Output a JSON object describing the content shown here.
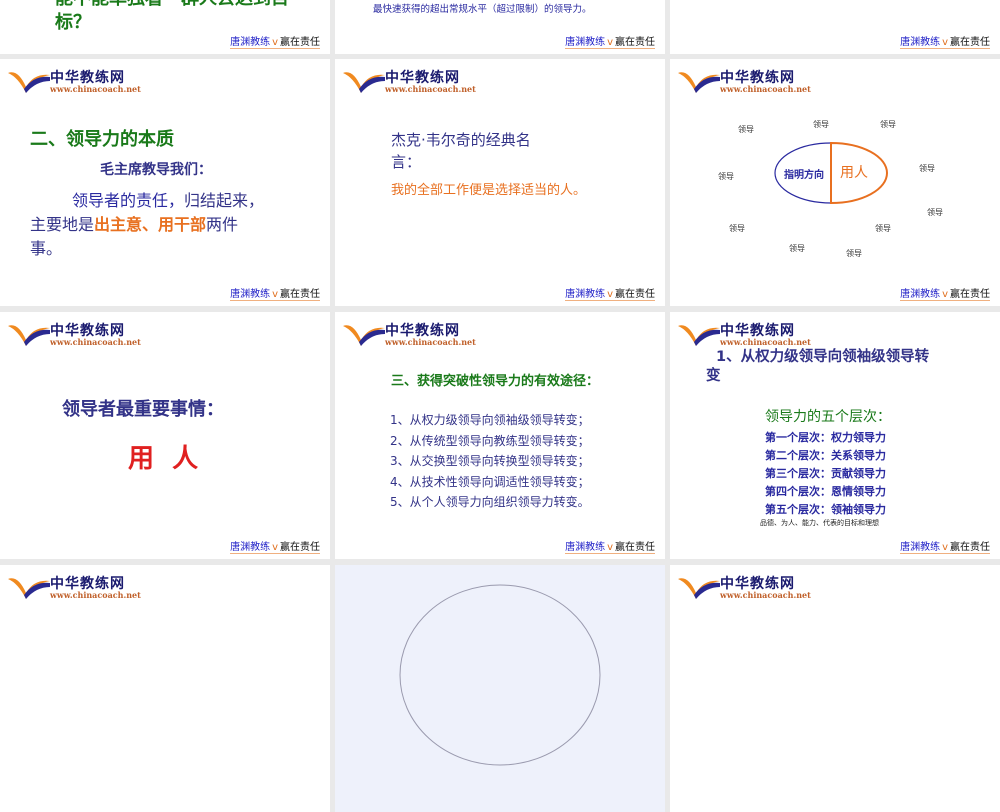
{
  "logo": {
    "brand": "中华教练网",
    "url": "www.chinacoach.net"
  },
  "footer": {
    "name": "唐渊教练",
    "v": "v",
    "slogan": "赢在责任"
  },
  "slides": [
    {
      "line1": "能不能单独看一群人去达到目",
      "line2": "标？"
    },
    {
      "text": "最快速获得的超出常规水平（超过限制）的领导力。"
    },
    {},
    {
      "title": "二、领导力的本质",
      "subtitle": "毛主席教导我们：",
      "p1": "领导者的责任，",
      "p1b": "归结起来，",
      "p2a": "主要地是",
      "p2b": "出主意、用干部",
      "p2c": "两件",
      "p3": "事。"
    },
    {
      "title_line1": "杰克·韦尔奇的经典名",
      "title_line2": "言：",
      "quote": "我的全部工作便是选择适当的人。"
    },
    {
      "left": "指明方向",
      "right": "用人",
      "satellite": "领导"
    },
    {
      "heading": "领导者最重要事情：",
      "big": "用  人"
    },
    {
      "title": "三、获得突破性领导力的有效途径：",
      "items": [
        "1、从权力级领导向领袖级领导转变；",
        "2、从传统型领导向教练型领导转变；",
        "3、从交换型领导向转换型领导转变；",
        "4、从技术性领导向调适性领导转变；",
        "5、从个人领导力向组织领导力转变。"
      ]
    },
    {
      "title_line1": "1、从权力级领导向领袖级领导转",
      "title_line2": "变",
      "subtitle": "领导力的五个层次：",
      "levels": [
        "第一个层次：权力领导力",
        "第二个层次：关系领导力",
        "第三个层次：贡献领导力",
        "第四个层次：恩情领导力",
        "第五个层次：领袖领导力"
      ],
      "note": "品德、为人、能力、代表的目标和理想"
    }
  ],
  "colors": {
    "green": "#1a7a1a",
    "blue": "#2a2aa0",
    "orange": "#e87020"
  }
}
